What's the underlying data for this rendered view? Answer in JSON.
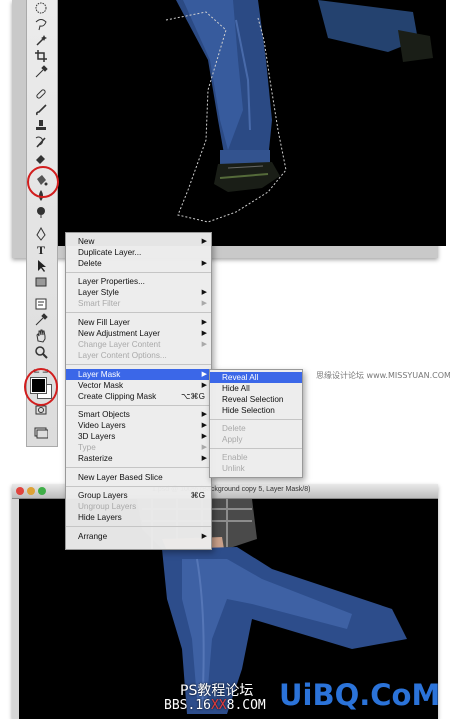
{
  "app": {
    "accent_color": "#3b67e8",
    "highlight_color": "#d21e1e"
  },
  "context_menu": {
    "items": [
      {
        "label": "New",
        "submenu": true,
        "enabled": true
      },
      {
        "label": "Duplicate Layer...",
        "submenu": false,
        "enabled": true
      },
      {
        "label": "Delete",
        "submenu": true,
        "enabled": true
      },
      {
        "label": "Layer Properties...",
        "submenu": false,
        "enabled": true
      },
      {
        "label": "Layer Style",
        "submenu": true,
        "enabled": true
      },
      {
        "label": "Smart Filter",
        "submenu": true,
        "enabled": false
      },
      {
        "label": "New Fill Layer",
        "submenu": true,
        "enabled": true
      },
      {
        "label": "New Adjustment Layer",
        "submenu": true,
        "enabled": true
      },
      {
        "label": "Change Layer Content",
        "submenu": true,
        "enabled": false
      },
      {
        "label": "Layer Content Options...",
        "submenu": false,
        "enabled": false
      },
      {
        "label": "Layer Mask",
        "submenu": true,
        "enabled": true,
        "selected": true
      },
      {
        "label": "Vector Mask",
        "submenu": true,
        "enabled": true
      },
      {
        "label": "Create Clipping Mask",
        "shortcut": "⌥⌘G",
        "enabled": true
      },
      {
        "label": "Smart Objects",
        "submenu": true,
        "enabled": true
      },
      {
        "label": "Video Layers",
        "submenu": true,
        "enabled": true
      },
      {
        "label": "3D Layers",
        "submenu": true,
        "enabled": true
      },
      {
        "label": "Type",
        "submenu": true,
        "enabled": false
      },
      {
        "label": "Rasterize",
        "submenu": true,
        "enabled": true
      },
      {
        "label": "New Layer Based Slice",
        "submenu": false,
        "enabled": true
      },
      {
        "label": "Group Layers",
        "shortcut": "⌘G",
        "enabled": true
      },
      {
        "label": "Ungroup Layers",
        "enabled": false
      },
      {
        "label": "Hide Layers",
        "enabled": true
      },
      {
        "label": "Arrange",
        "submenu": true,
        "enabled": true
      }
    ]
  },
  "layer_mask_submenu": {
    "items": [
      {
        "label": "Reveal All",
        "enabled": true,
        "selected": true
      },
      {
        "label": "Hide All",
        "enabled": true
      },
      {
        "label": "Reveal Selection",
        "enabled": true
      },
      {
        "label": "Hide Selection",
        "enabled": true
      },
      {
        "label": "Delete",
        "enabled": false
      },
      {
        "label": "Apply",
        "enabled": false
      },
      {
        "label": "Enable",
        "enabled": false
      },
      {
        "label": "Unlink",
        "enabled": false
      }
    ]
  },
  "watermarks": {
    "top_right": "思缘设计论坛 www.MISSYUAN.COM",
    "ps_forum": "PS教程论坛",
    "bbs_prefix": "BBS.16",
    "bbs_xx": "XX",
    "bbs_suffix": "8.COM",
    "uibq": "UiBQ.CoM"
  },
  "second_window": {
    "title": "1.psd @ 100% (Background copy 5, Layer Mask/8)"
  },
  "tools": [
    "marquee-icon",
    "lasso-icon",
    "magic-wand-icon",
    "crop-icon",
    "eyedropper-icon",
    "healing-icon",
    "brush-icon",
    "stamp-icon",
    "history-brush-icon",
    "eraser-icon",
    "paint-bucket-icon",
    "blur-icon",
    "dodge-icon",
    "pen-icon",
    "type-icon",
    "path-select-icon",
    "shape-icon",
    "notes-icon",
    "eyedropper2-icon",
    "hand-icon",
    "zoom-icon"
  ]
}
